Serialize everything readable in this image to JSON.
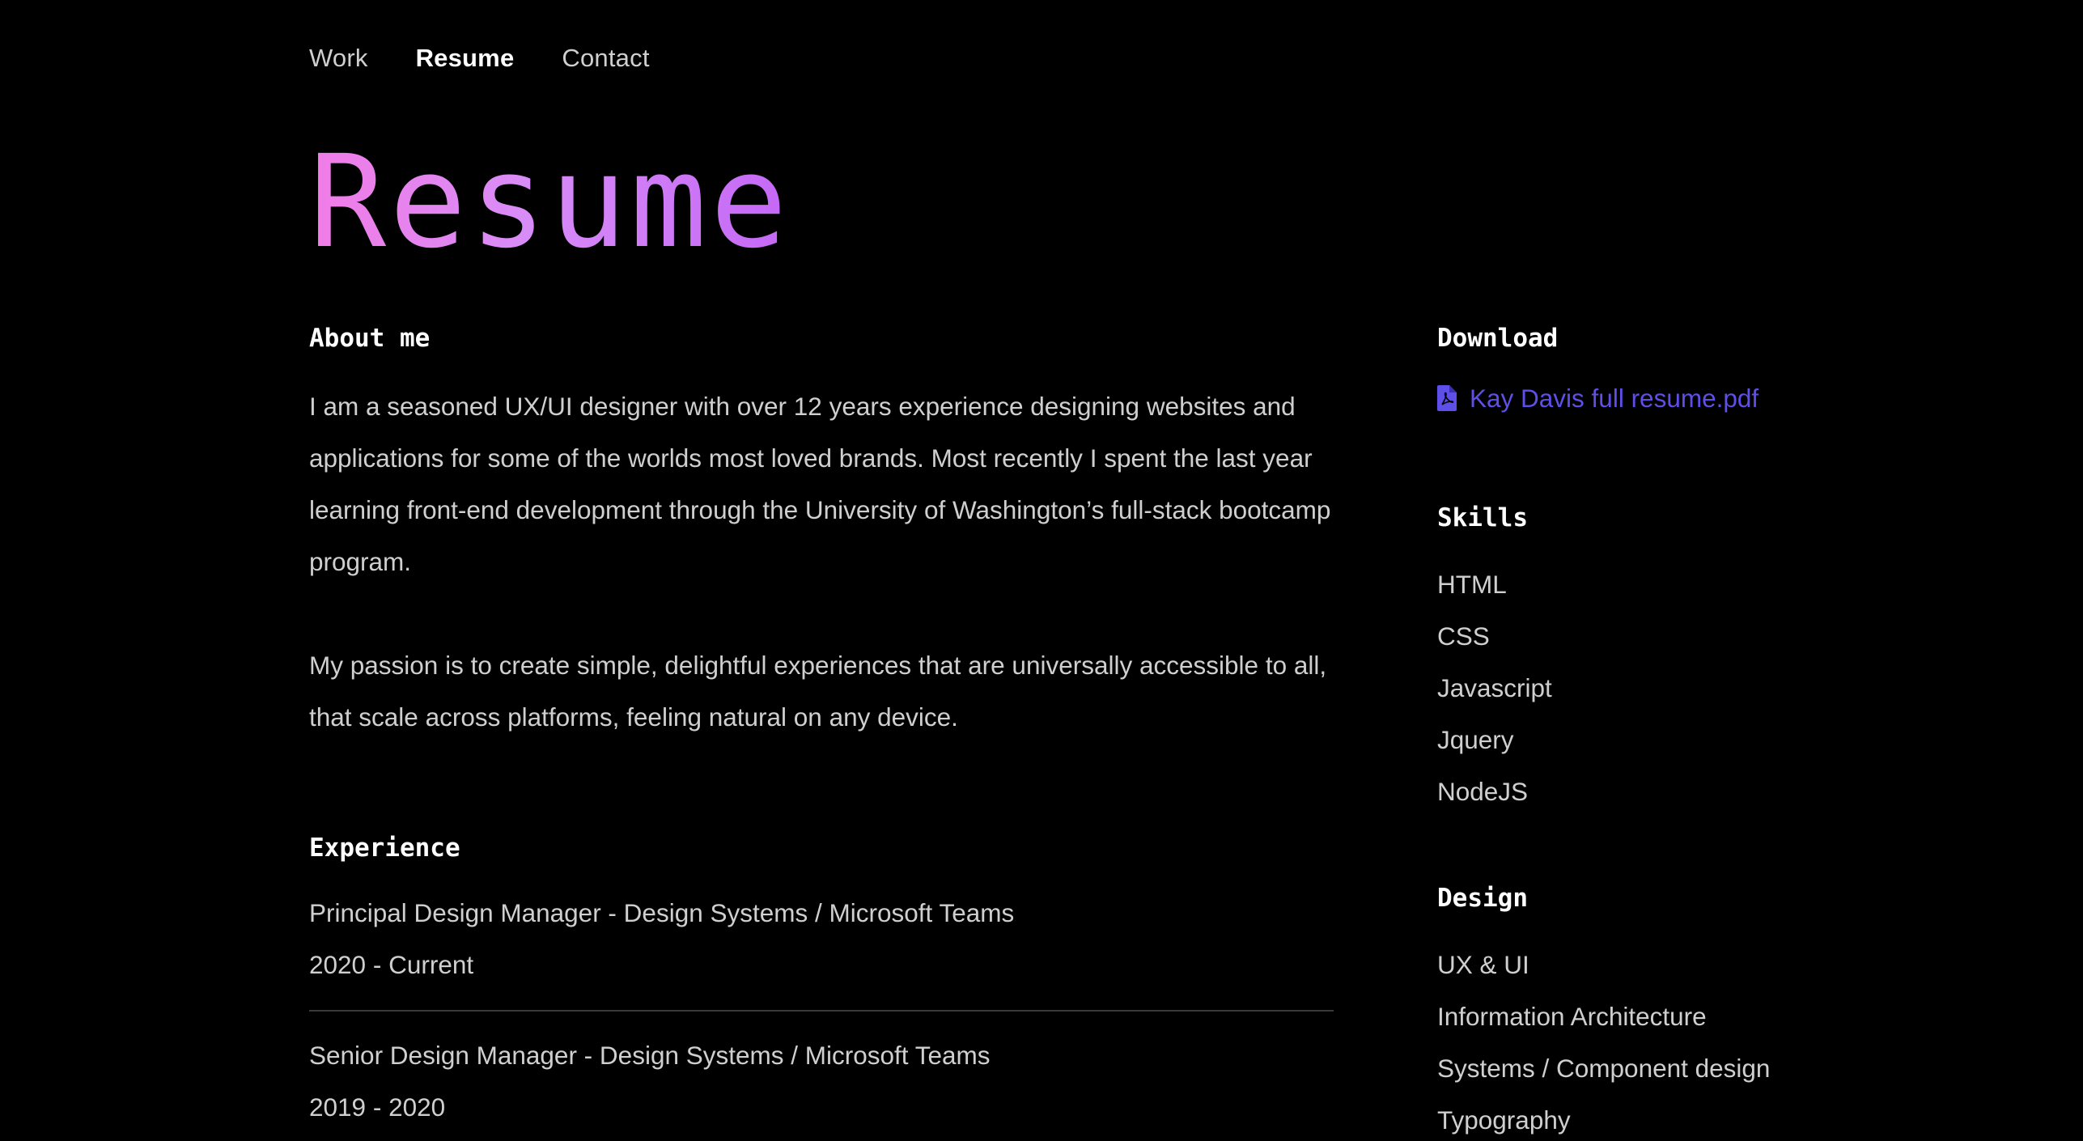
{
  "nav": {
    "items": [
      {
        "label": "Work",
        "active": false
      },
      {
        "label": "Resume",
        "active": true
      },
      {
        "label": "Contact",
        "active": false
      }
    ]
  },
  "page": {
    "title": "Resume",
    "title_gradient": [
      "#f27ce6",
      "#c468f6"
    ]
  },
  "about": {
    "heading": "About me",
    "paragraphs": [
      "I am a seasoned UX/UI designer with over 12 years experience designing websites and applications for some of the worlds most loved brands. Most recently I spent the last year learning front-end development through the University of Washington’s full-stack bootcamp program.",
      "My passion is to create simple, delightful experiences that are universally accessible to all, that scale across platforms, feeling natural on any device."
    ]
  },
  "experience": {
    "heading": "Experience",
    "items": [
      {
        "title": "Principal Design Manager - Design Systems / Microsoft Teams",
        "dates": "2020 - Current"
      },
      {
        "title": "Senior Design Manager - Design Systems / Microsoft Teams",
        "dates": "2019 - 2020"
      }
    ]
  },
  "download": {
    "heading": "Download",
    "link_label": "Kay Davis full resume.pdf",
    "icon": "file-pdf-icon",
    "link_color": "#5e4fe8"
  },
  "skills": {
    "heading": "Skills",
    "items": [
      "HTML",
      "CSS",
      "Javascript",
      "Jquery",
      "NodeJS"
    ]
  },
  "design": {
    "heading": "Design",
    "items": [
      "UX & UI",
      "Information Architecture",
      "Systems / Component design",
      "Typography"
    ]
  },
  "colors": {
    "background": "#000000",
    "heading": "#ffffff",
    "body_text": "#cfcfcf",
    "divider": "#3a3a3a"
  }
}
